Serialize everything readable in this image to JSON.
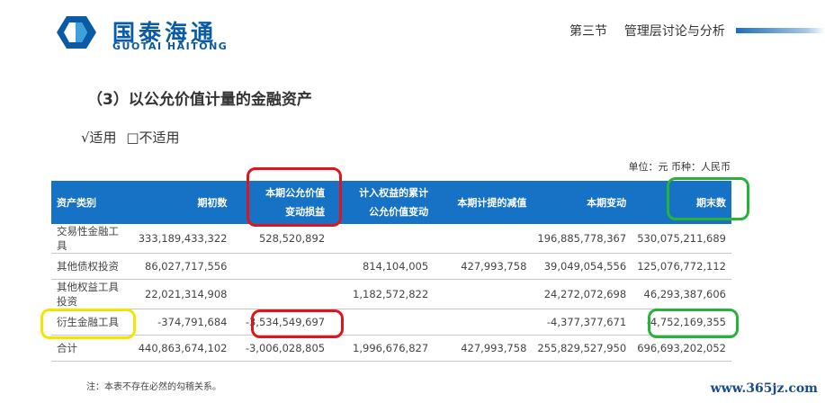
{
  "brand": {
    "cn": "国泰海通",
    "en": "GUOTAI HAITONG"
  },
  "header": {
    "section": "第三节",
    "title": "管理层讨论与分析"
  },
  "section_title": "（3）以公允价值计量的金融资产",
  "applicability": {
    "applicable": "√适用",
    "not_applicable": "□不适用"
  },
  "unit_line": "单位：元  币种：人民币",
  "table": {
    "headers": [
      {
        "line1": "资产类别",
        "line2": ""
      },
      {
        "line1": "期初数",
        "line2": ""
      },
      {
        "line1": "本期公允价值",
        "line2": "变动损益"
      },
      {
        "line1": "计入权益的累计",
        "line2": "公允价值变动"
      },
      {
        "line1": "本期计提的减值",
        "line2": ""
      },
      {
        "line1": "本期变动",
        "line2": ""
      },
      {
        "line1": "期末数",
        "line2": ""
      }
    ],
    "rows": [
      {
        "cells": [
          "交易性金融工具",
          "333,189,433,322",
          "528,520,892",
          "",
          "",
          "196,885,778,367",
          "530,075,211,689"
        ]
      },
      {
        "cells": [
          "其他债权投资",
          "86,027,717,556",
          "",
          "814,104,005",
          "427,993,758",
          "39,049,054,556",
          "125,076,772,112"
        ]
      },
      {
        "cells": [
          "其他权益工具投资",
          "22,021,314,908",
          "",
          "1,182,572,822",
          "",
          "24,272,072,698",
          "46,293,387,606"
        ]
      },
      {
        "cells": [
          "衍生金融工具",
          "-374,791,684",
          "-3,534,549,697",
          "",
          "",
          "-4,377,377,671",
          "-4,752,169,355"
        ]
      },
      {
        "cells": [
          "合计",
          "440,863,674,102",
          "-3,006,028,805",
          "1,996,676,827",
          "427,993,758",
          "255,829,527,950",
          "696,693,202,052"
        ]
      }
    ]
  },
  "note": "注：本表不存在必然的勾稽关系。",
  "watermark": "www.365jz.com",
  "colors": {
    "brand_blue": "#0a5aa6",
    "header_blue": "#1672c4",
    "mark_red": "#e0141e",
    "mark_green": "#27b33a",
    "mark_yellow": "#f5e400"
  }
}
